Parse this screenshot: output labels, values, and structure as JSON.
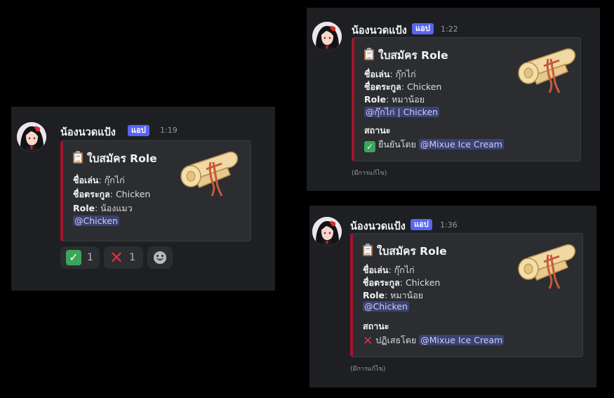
{
  "bot": {
    "name": "น้องนวดแป้ง",
    "badge": "แอป"
  },
  "embed_title": "ใบสมัคร Role",
  "field_labels": {
    "nickname": "ชื่อเล่น",
    "surname": "ชื่อตระกูล",
    "role": "Role",
    "status": "สถานะ"
  },
  "icons": {
    "clipboard": "clipboard-icon",
    "scroll": "scroll-icon",
    "check": "check-mark-icon",
    "cross": "cross-mark-icon",
    "emoji": "add-reaction-icon"
  },
  "colors": {
    "embed_border": "#a2142b",
    "mention_bg": "#3c4270",
    "badge": "#5865f2",
    "approve": "#3ba55c",
    "reject": "#e0323c"
  },
  "messages": [
    {
      "time": "1:19",
      "nickname": "กุ๊กไก่",
      "surname": "Chicken",
      "role": "น้องแมว",
      "mention": "@Chicken",
      "reactions": [
        {
          "emoji": "check",
          "count": "1"
        },
        {
          "emoji": "cross",
          "count": "1"
        }
      ]
    },
    {
      "time": "1:22",
      "nickname": "กุ๊กไก่",
      "surname": "Chicken",
      "role": "หมาน้อย",
      "mention": "@กุ๊กไก่ | Chicken",
      "status_text": "ยืนยันโดย",
      "status_by": "@Mixue Ice Cream",
      "edited": "(มีการแก้ไข)"
    },
    {
      "time": "1:36",
      "nickname": "กุ๊กไก่",
      "surname": "Chicken",
      "role": "หมาน้อย",
      "mention": "@Chicken",
      "status_text": "ปฏิเสธโดย",
      "status_by": "@Mixue Ice Cream",
      "edited": "(มีการแก้ไข)"
    }
  ]
}
